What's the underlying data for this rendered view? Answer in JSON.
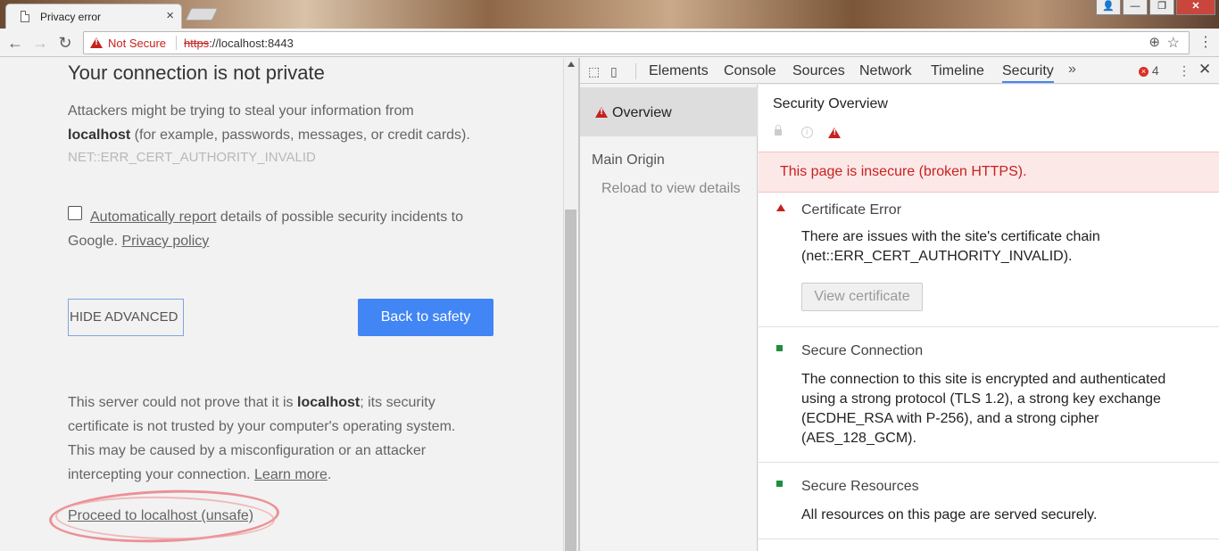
{
  "browser": {
    "tab_title": "Privacy error",
    "tab_close": "×",
    "window_buttons": [
      "👤",
      "—",
      "❐",
      "✕"
    ],
    "nav": {
      "back": "←",
      "forward": "→",
      "reload": "↻"
    },
    "omnibox": {
      "security_label": "Not Secure",
      "url_scheme": "https",
      "url_rest": "://localhost:8443",
      "zoom_icon": "⊕",
      "star_icon": "☆"
    },
    "menu": "⋮"
  },
  "page": {
    "heading": "Your connection is not private",
    "para1_a": "Attackers might be trying to steal your information from",
    "para1_host": "localhost",
    "para1_b": " (for example, passwords, messages, or credit cards).",
    "error_code": "NET::ERR_CERT_AUTHORITY_INVALID",
    "report_link": "Automatically report",
    "report_text": " details of possible security incidents to",
    "report_text2": "Google. ",
    "privacy_link": "Privacy policy",
    "hide_advanced": "HIDE ADVANCED",
    "back_to_safety": "Back to safety",
    "adv_a": "This server could not prove that it is ",
    "adv_host": "localhost",
    "adv_b": "; its security",
    "adv_line2": "certificate is not trusted by your computer's operating system.",
    "adv_line3": "This may be caused by a misconfiguration or an attacker",
    "adv_line4a": "intercepting your connection. ",
    "learn_more": "Learn more",
    "adv_line4b": ".",
    "proceed_link": "Proceed to localhost (unsafe)"
  },
  "devtools": {
    "tabs": [
      "Elements",
      "Console",
      "Sources",
      "Network",
      "Timeline",
      "Security"
    ],
    "active_tab": "Security",
    "more": "»",
    "error_count": "4",
    "kebab": "⋮",
    "close": "✕",
    "sidebar": {
      "overview": "Overview",
      "main_origin": "Main Origin",
      "reload_hint": "Reload to view details"
    },
    "main": {
      "title": "Security Overview",
      "banner": "This page is insecure (broken HTTPS).",
      "cards": [
        {
          "status": "insecure",
          "title": "Certificate Error",
          "desc": "There are issues with the site's certificate chain (net::ERR_CERT_AUTHORITY_INVALID).",
          "button": "View certificate"
        },
        {
          "status": "secure",
          "title": "Secure Connection",
          "desc": "The connection to this site is encrypted and authenticated using a strong protocol (TLS 1.2), a strong key exchange (ECDHE_RSA with P-256), and a strong cipher (AES_128_GCM)."
        },
        {
          "status": "secure",
          "title": "Secure Resources",
          "desc": "All resources on this page are served securely."
        }
      ]
    }
  },
  "colors": {
    "insecure": "#c5221f",
    "secure": "#1e8e3e",
    "primary_button": "#4285f4",
    "annotation": "#e8787e"
  }
}
